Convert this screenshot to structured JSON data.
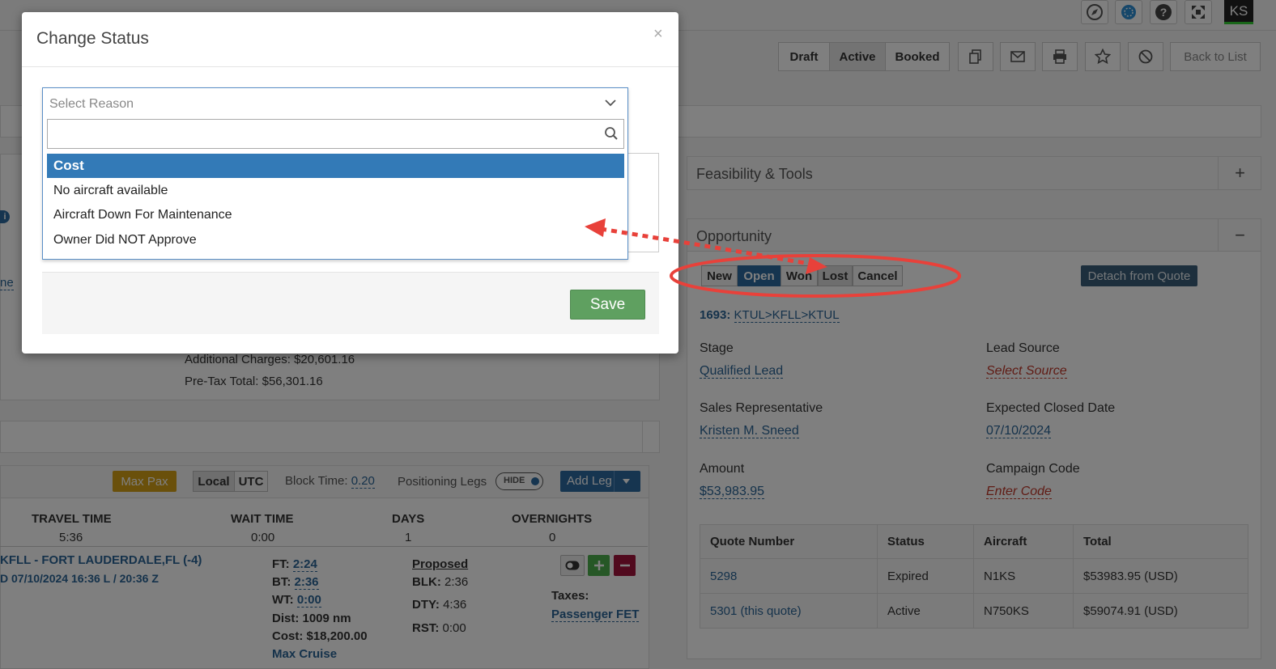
{
  "topbar": {
    "user_initials": "KS",
    "icons": [
      "compass-icon",
      "globe-icon",
      "help-icon",
      "expand-icon"
    ]
  },
  "toolbar": {
    "status_buttons": [
      "Draft",
      "Active",
      "Booked"
    ],
    "back_label": "Back to List"
  },
  "feasibility": {
    "title": "Feasibility & Tools",
    "toggle": "+"
  },
  "opportunity": {
    "title": "Opportunity",
    "toggle": "−",
    "status_options": [
      "New",
      "Open",
      "Won",
      "Lost",
      "Cancel"
    ],
    "detach_label": "Detach from Quote",
    "trip_id": "1693:",
    "trip_route": "KTUL>KFLL>KTUL",
    "stage_label": "Stage",
    "stage_value": "Qualified Lead",
    "lead_source_label": "Lead Source",
    "lead_source_value": "Select Source",
    "sales_rep_label": "Sales Representative",
    "sales_rep_value": "Kristen M. Sneed",
    "expected_close_label": "Expected Closed Date",
    "expected_close_value": "07/10/2024",
    "amount_label": "Amount",
    "amount_value": "$53,983.95",
    "campaign_label": "Campaign Code",
    "campaign_value": "Enter Code",
    "quotes_table": {
      "headers": [
        "Quote Number",
        "Status",
        "Aircraft",
        "Total"
      ],
      "rows": [
        [
          "5298",
          "Expired",
          "N1KS",
          "$53983.95 (USD)"
        ],
        [
          "5301 (this quote)",
          "Active",
          "N750KS",
          "$59074.91 (USD)"
        ]
      ]
    }
  },
  "charges": {
    "additional": "Additional Charges: $20,601.16",
    "pretax": "Pre-Tax Total: $56,301.16"
  },
  "legs_toolbar": {
    "max_pax": "Max Pax",
    "local": "Local",
    "utc": "UTC",
    "block_time_label": "Block Time:",
    "block_time_value": "0.20",
    "positioning_label": "Positioning Legs",
    "hide_label": "HIDE",
    "add_leg": "Add Leg"
  },
  "summary": {
    "headers": [
      "TRAVEL TIME",
      "WAIT TIME",
      "DAYS",
      "OVERNIGHTS"
    ],
    "values": [
      "5:36",
      "0:00",
      "1",
      "0"
    ]
  },
  "leg": {
    "route": "KFLL - FORT LAUDERDALE,FL (-4)",
    "time": "D 07/10/2024 16:36 L / 20:36 Z",
    "ft_label": "FT:",
    "ft_value": "2:24",
    "bt_label": "BT:",
    "bt_value": "2:36",
    "wt_label": "WT:",
    "wt_value": "0:00",
    "dist": "Dist: 1009 nm",
    "cost": "Cost: $18,200.00",
    "cruise": "Max Cruise",
    "proposed": "Proposed",
    "blk_label": "BLK:",
    "blk_value": "2:36",
    "dty_label": "DTY:",
    "dty_value": "4:36",
    "rst_label": "RST:",
    "rst_value": "0:00",
    "taxes_label": "Taxes:",
    "taxes_value": "Passenger FET"
  },
  "left_fragments": {
    "info": "i",
    "link_fragment": "ne"
  },
  "modal": {
    "title": "Change Status",
    "close": "×",
    "select_placeholder": "Select Reason",
    "search_value": "",
    "options": [
      "Cost",
      "No aircraft available",
      "Aircraft Down For Maintenance",
      "Owner Did NOT Approve"
    ],
    "selected_index": 0,
    "save_label": "Save"
  },
  "colors": {
    "primary": "#337ab7",
    "dark_btn": "#3a5f7a",
    "save_green": "#5cb85c",
    "annotation_red": "#e8413a",
    "maxpax": "#d4a017"
  }
}
